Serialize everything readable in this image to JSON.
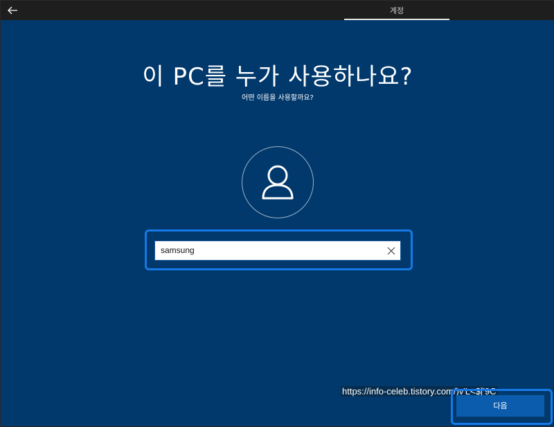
{
  "header": {
    "back_icon": "arrow-left-icon",
    "tab_label": "계정"
  },
  "main": {
    "title": "이 PC를 누가 사용하나요?",
    "subtitle": "어떤 이름을 사용할까요?",
    "avatar_icon": "user-icon",
    "name_input": {
      "value": "samsung",
      "clear_icon": "close-icon"
    }
  },
  "footer": {
    "watermark": "https://info-celeb.tistory.com/)v'L<$['9C",
    "next_label": "다음"
  },
  "colors": {
    "background": "#003b70",
    "topbar": "#1e1e1e",
    "focus_ring": "#1679e8",
    "button": "#0b5cad"
  }
}
